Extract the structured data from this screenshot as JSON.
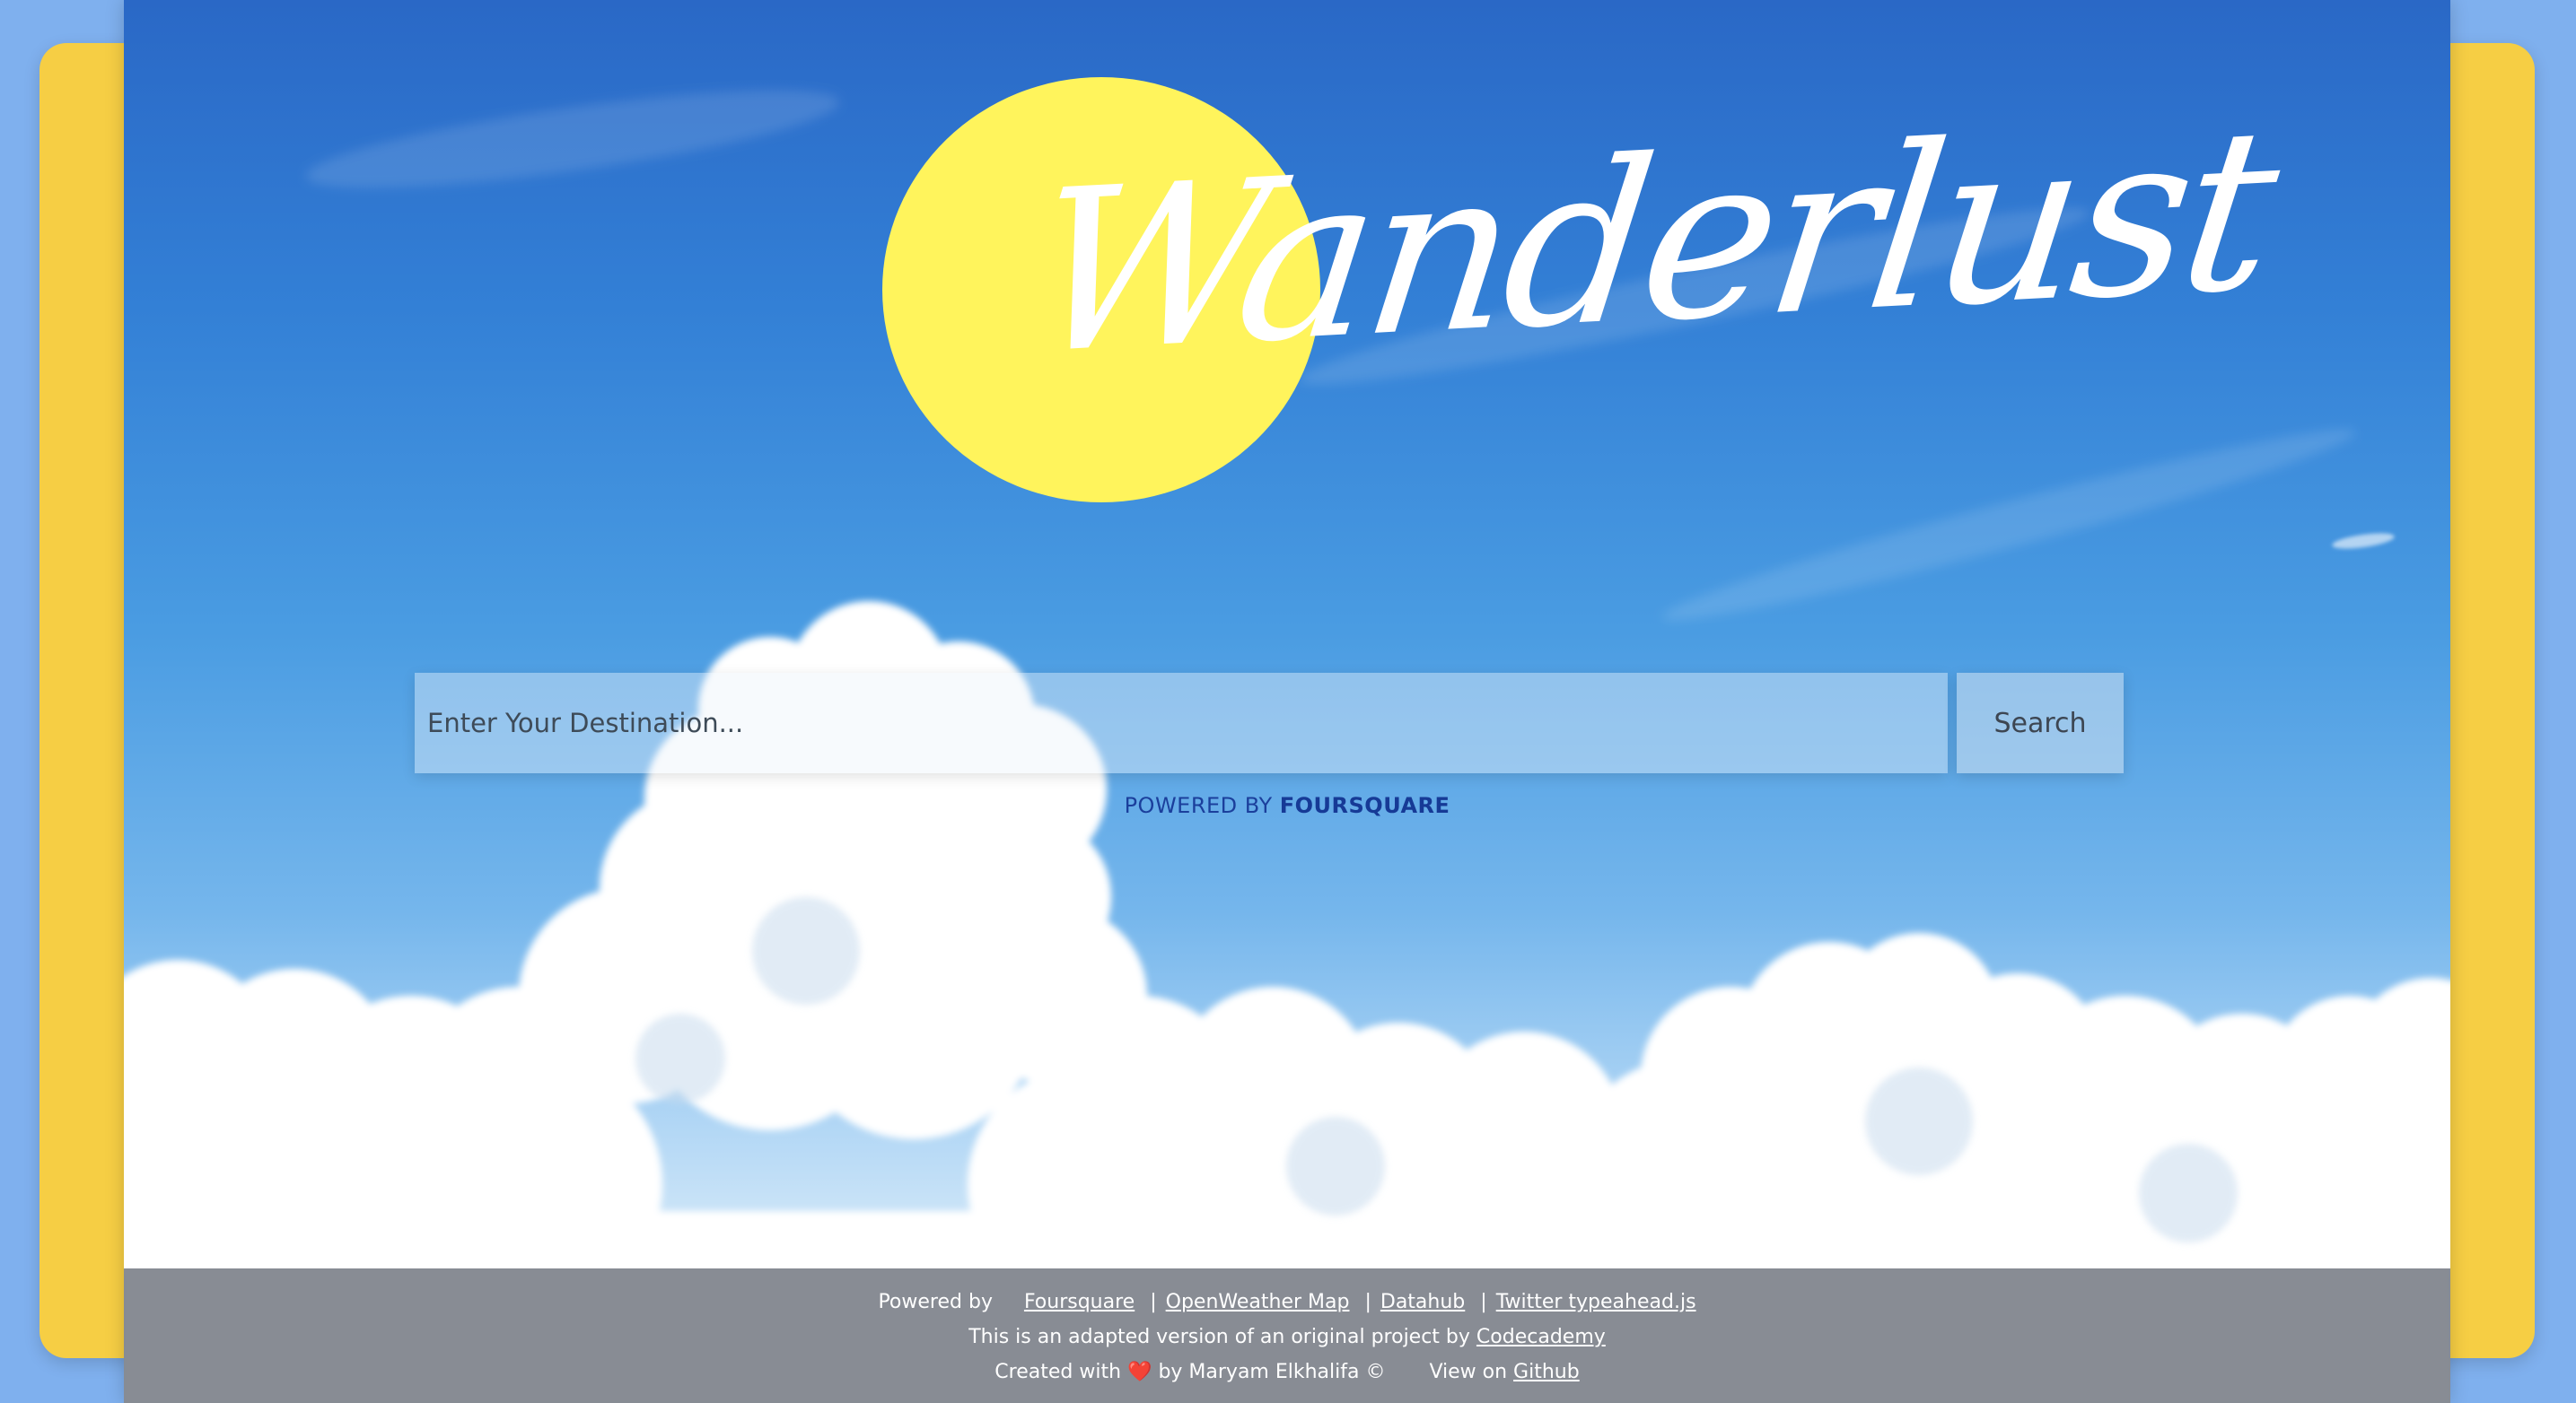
{
  "logo": {
    "text": "Wanderlust"
  },
  "search": {
    "placeholder": "Enter Your Destination...",
    "button_label": "Search"
  },
  "attribution": {
    "prefix": "POWERED BY",
    "brand": "FOURSQUARE"
  },
  "footer": {
    "powered_by_label": "Powered by",
    "links": [
      "Foursquare",
      "OpenWeather Map",
      "Datahub",
      "Twitter typeahead.js"
    ],
    "separator": "|",
    "adapted_text": "This is an adapted version of an original project by",
    "adapted_link": "Codecademy",
    "created_prefix": "Created with",
    "heart": "❤️",
    "created_suffix": "by Maryam Elkhalifa ©",
    "view_on": "View on",
    "github_link": "Github"
  },
  "colors": {
    "page_bg": "#7fb0ee",
    "card": "#f6ce44",
    "sun": "#fff45c",
    "attribution": "#1b3f9c"
  }
}
